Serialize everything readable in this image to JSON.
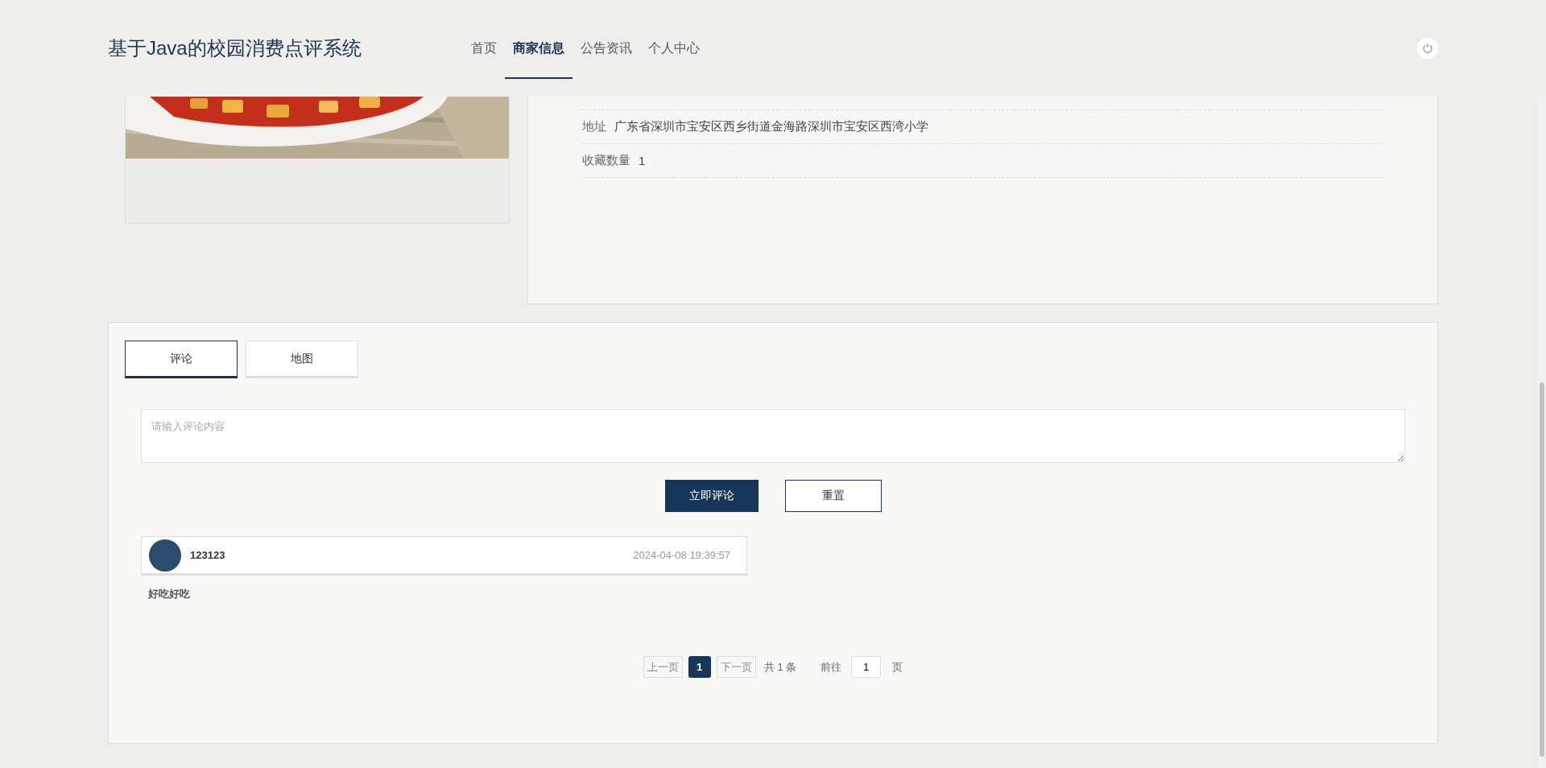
{
  "header": {
    "title": "基于Java的校园消费点评系统",
    "nav": [
      {
        "label": "首页",
        "selected": false
      },
      {
        "label": "商家信息",
        "selected": true
      },
      {
        "label": "公告资讯",
        "selected": false
      },
      {
        "label": "个人中心",
        "selected": false
      }
    ]
  },
  "merchant": {
    "details": [
      {
        "label": "地址",
        "value": "广东省深圳市宝安区西乡街道金海路深圳市宝安区西湾小学"
      },
      {
        "label": "收藏数量",
        "value": "1"
      }
    ]
  },
  "tabs": [
    {
      "label": "评论",
      "selected": true
    },
    {
      "label": "地图",
      "selected": false
    }
  ],
  "comment_form": {
    "placeholder": "请输入评论内容",
    "buttons": [
      {
        "label": "立即评论",
        "kind": "primary"
      },
      {
        "label": "重置",
        "kind": "secondary"
      }
    ]
  },
  "comments": [
    {
      "username": "123123",
      "time": "2024-04-08 19:39:57",
      "content": "好吃好吃"
    }
  ],
  "pagination": {
    "prev": {
      "label": "上一页",
      "disabled": true
    },
    "pages": [
      {
        "label": "1",
        "selected": true
      }
    ],
    "next": {
      "label": "下一页",
      "disabled": true
    },
    "total": "共 1 条",
    "goto": "前往",
    "page_input": "1",
    "suffix": "页"
  }
}
